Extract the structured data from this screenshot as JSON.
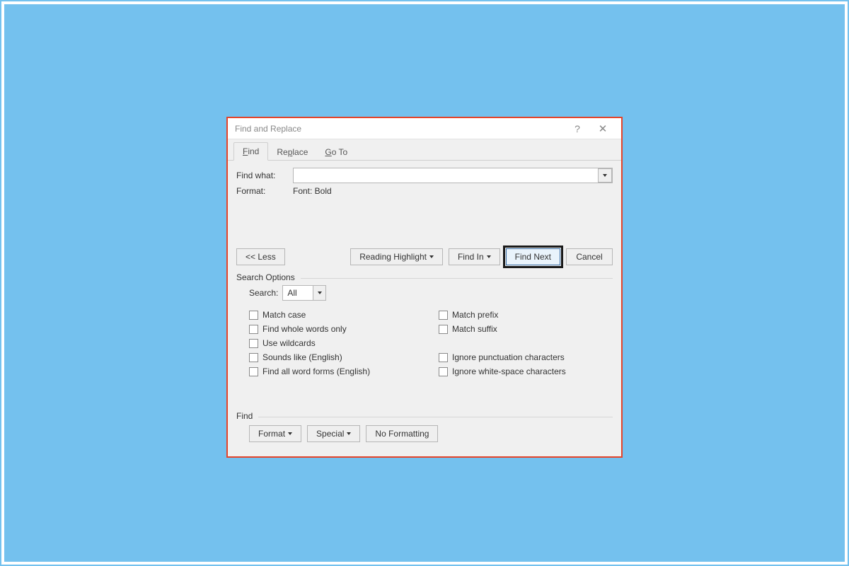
{
  "dialog": {
    "title": "Find and Replace",
    "tabs": [
      {
        "label_pre": "",
        "label_ul": "F",
        "label_post": "ind"
      },
      {
        "label_pre": "Re",
        "label_ul": "p",
        "label_post": "lace"
      },
      {
        "label_pre": "",
        "label_ul": "G",
        "label_post": "o To"
      }
    ],
    "find_what_label": "Find what:",
    "find_what_value": "",
    "format_label": "Format:",
    "format_value": "Font: Bold",
    "buttons": {
      "less": "<< Less",
      "reading_highlight": "Reading Highlight",
      "find_in": "Find In",
      "find_next": "Find Next",
      "cancel": "Cancel"
    },
    "search_options": {
      "legend": "Search Options",
      "search_label": "Search:",
      "search_value": "All",
      "left": {
        "match_case": "Match case",
        "whole_words_pre": "Find whole words onl",
        "whole_words_ul": "y",
        "wildcards_pre": "Use wil",
        "wildcards_ul": "d",
        "wildcards_post": "cards",
        "sounds_like": "Sounds like (English)",
        "word_forms_pre": "Find all ",
        "word_forms_ul": "w",
        "word_forms_post": "ord forms (English)"
      },
      "right": {
        "match_prefix": "Match prefix",
        "match_suffix": "Match suffix",
        "ignore_punct_pre": "Ignore punctuation character",
        "ignore_punct_ul": "s",
        "ignore_ws": "Ignore white-space characters"
      }
    },
    "find_footer": {
      "legend": "Find",
      "format_pre": "F",
      "format_ul": "o",
      "format_post": "rmat",
      "special_pre": "Sp",
      "special_ul": "e",
      "special_post": "cial",
      "no_formatting_pre": "No Forma",
      "no_formatting_ul": "t",
      "no_formatting_post": "ting"
    }
  }
}
